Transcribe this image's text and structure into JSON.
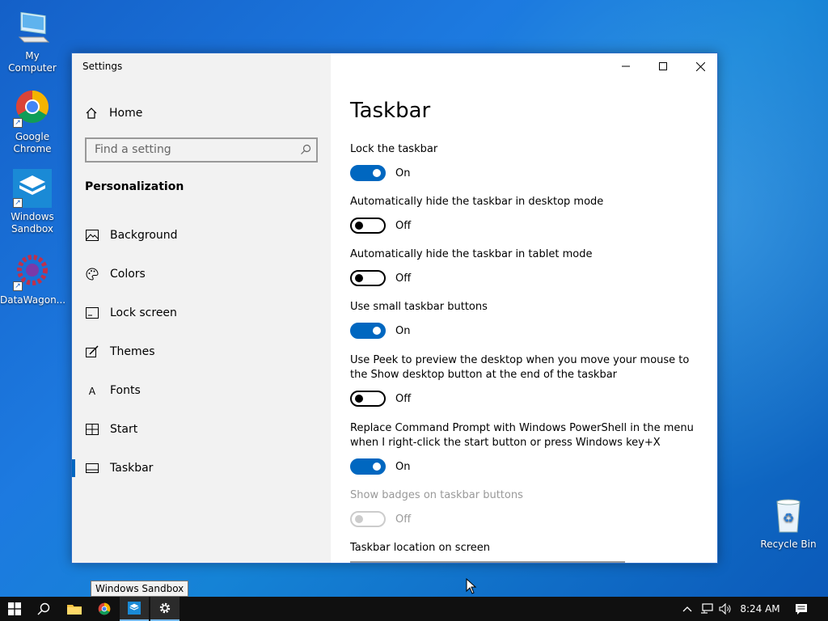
{
  "desktop": {
    "icons": [
      {
        "label": "My Computer"
      },
      {
        "label": "Google Chrome"
      },
      {
        "label": "Windows Sandbox"
      },
      {
        "label": "DataWagon..."
      },
      {
        "label": "Recycle Bin"
      }
    ]
  },
  "window": {
    "title": "Settings",
    "sidebar": {
      "home_label": "Home",
      "search_placeholder": "Find a setting",
      "section_title": "Personalization",
      "items": [
        {
          "label": "Background",
          "icon": "picture-icon"
        },
        {
          "label": "Colors",
          "icon": "palette-icon"
        },
        {
          "label": "Lock screen",
          "icon": "lock-screen-icon"
        },
        {
          "label": "Themes",
          "icon": "brush-icon"
        },
        {
          "label": "Fonts",
          "icon": "font-icon"
        },
        {
          "label": "Start",
          "icon": "start-icon"
        },
        {
          "label": "Taskbar",
          "icon": "taskbar-icon",
          "selected": true
        }
      ]
    },
    "content": {
      "title": "Taskbar",
      "settings": [
        {
          "label": "Lock the taskbar",
          "state": "On"
        },
        {
          "label": "Automatically hide the taskbar in desktop mode",
          "state": "Off"
        },
        {
          "label": "Automatically hide the taskbar in tablet mode",
          "state": "Off"
        },
        {
          "label": "Use small taskbar buttons",
          "state": "On"
        },
        {
          "label": "Use Peek to preview the desktop when you move your mouse to the Show desktop button at the end of the taskbar",
          "state": "Off"
        },
        {
          "label": "Replace Command Prompt with Windows PowerShell in the menu when I right-click the start button or press Windows key+X",
          "state": "On"
        },
        {
          "label": "Show badges on taskbar buttons",
          "state": "Off",
          "disabled": true
        }
      ],
      "location_label": "Taskbar location on screen"
    }
  },
  "taskbar": {
    "tooltip": "Windows Sandbox",
    "clock": "8:24 AM"
  },
  "colors": {
    "accent": "#0067c0",
    "sidebar_bg": "#f2f2f2",
    "taskbar_bg": "#101010"
  }
}
